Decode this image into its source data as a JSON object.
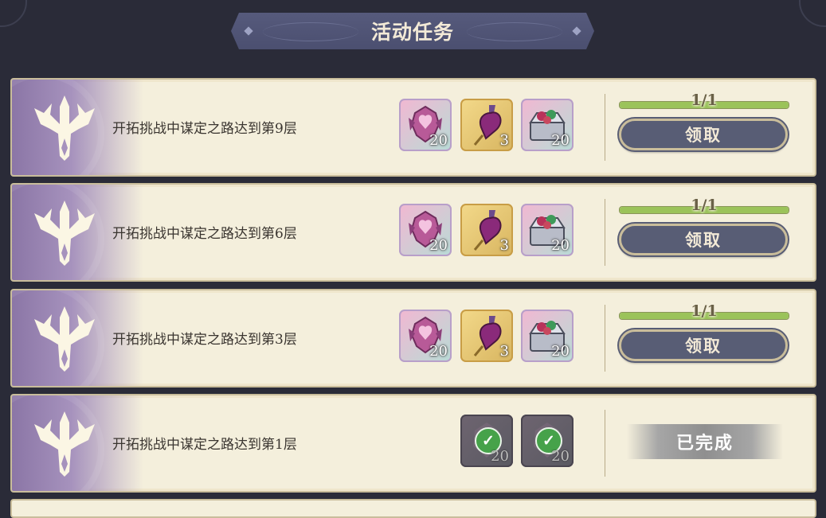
{
  "header": {
    "title": "活动任务"
  },
  "quests": [
    {
      "description": "开拓挑战中谋定之路达到第9层",
      "rewards": [
        {
          "icon": "pink-crest-icon",
          "style": "pink",
          "qty": "20"
        },
        {
          "icon": "heart-potion-icon",
          "style": "gold",
          "qty": "3"
        },
        {
          "icon": "gem-chest-icon",
          "style": "pink",
          "qty": "20"
        }
      ],
      "progress_text": "1/1",
      "progress_fraction": 1.0,
      "action_label": "领取",
      "completed": false
    },
    {
      "description": "开拓挑战中谋定之路达到第6层",
      "rewards": [
        {
          "icon": "pink-crest-icon",
          "style": "pink",
          "qty": "20"
        },
        {
          "icon": "heart-potion-icon",
          "style": "gold",
          "qty": "3"
        },
        {
          "icon": "gem-chest-icon",
          "style": "pink",
          "qty": "20"
        }
      ],
      "progress_text": "1/1",
      "progress_fraction": 1.0,
      "action_label": "领取",
      "completed": false
    },
    {
      "description": "开拓挑战中谋定之路达到第3层",
      "rewards": [
        {
          "icon": "pink-crest-icon",
          "style": "pink",
          "qty": "20"
        },
        {
          "icon": "heart-potion-icon",
          "style": "gold",
          "qty": "3"
        },
        {
          "icon": "gem-chest-icon",
          "style": "pink",
          "qty": "20"
        }
      ],
      "progress_text": "1/1",
      "progress_fraction": 1.0,
      "action_label": "领取",
      "completed": false
    },
    {
      "description": "开拓挑战中谋定之路达到第1层",
      "rewards": [
        {
          "icon": "claimed-reward-icon",
          "style": "done",
          "qty": "20"
        },
        {
          "icon": "claimed-reward-icon",
          "style": "done",
          "qty": "20"
        }
      ],
      "status_label": "已完成",
      "completed": true
    }
  ],
  "colors": {
    "background": "#2a2b38",
    "card": "#f4efdc",
    "button": "#585d75",
    "progress": "#9bc35a",
    "check": "#46a24a"
  }
}
